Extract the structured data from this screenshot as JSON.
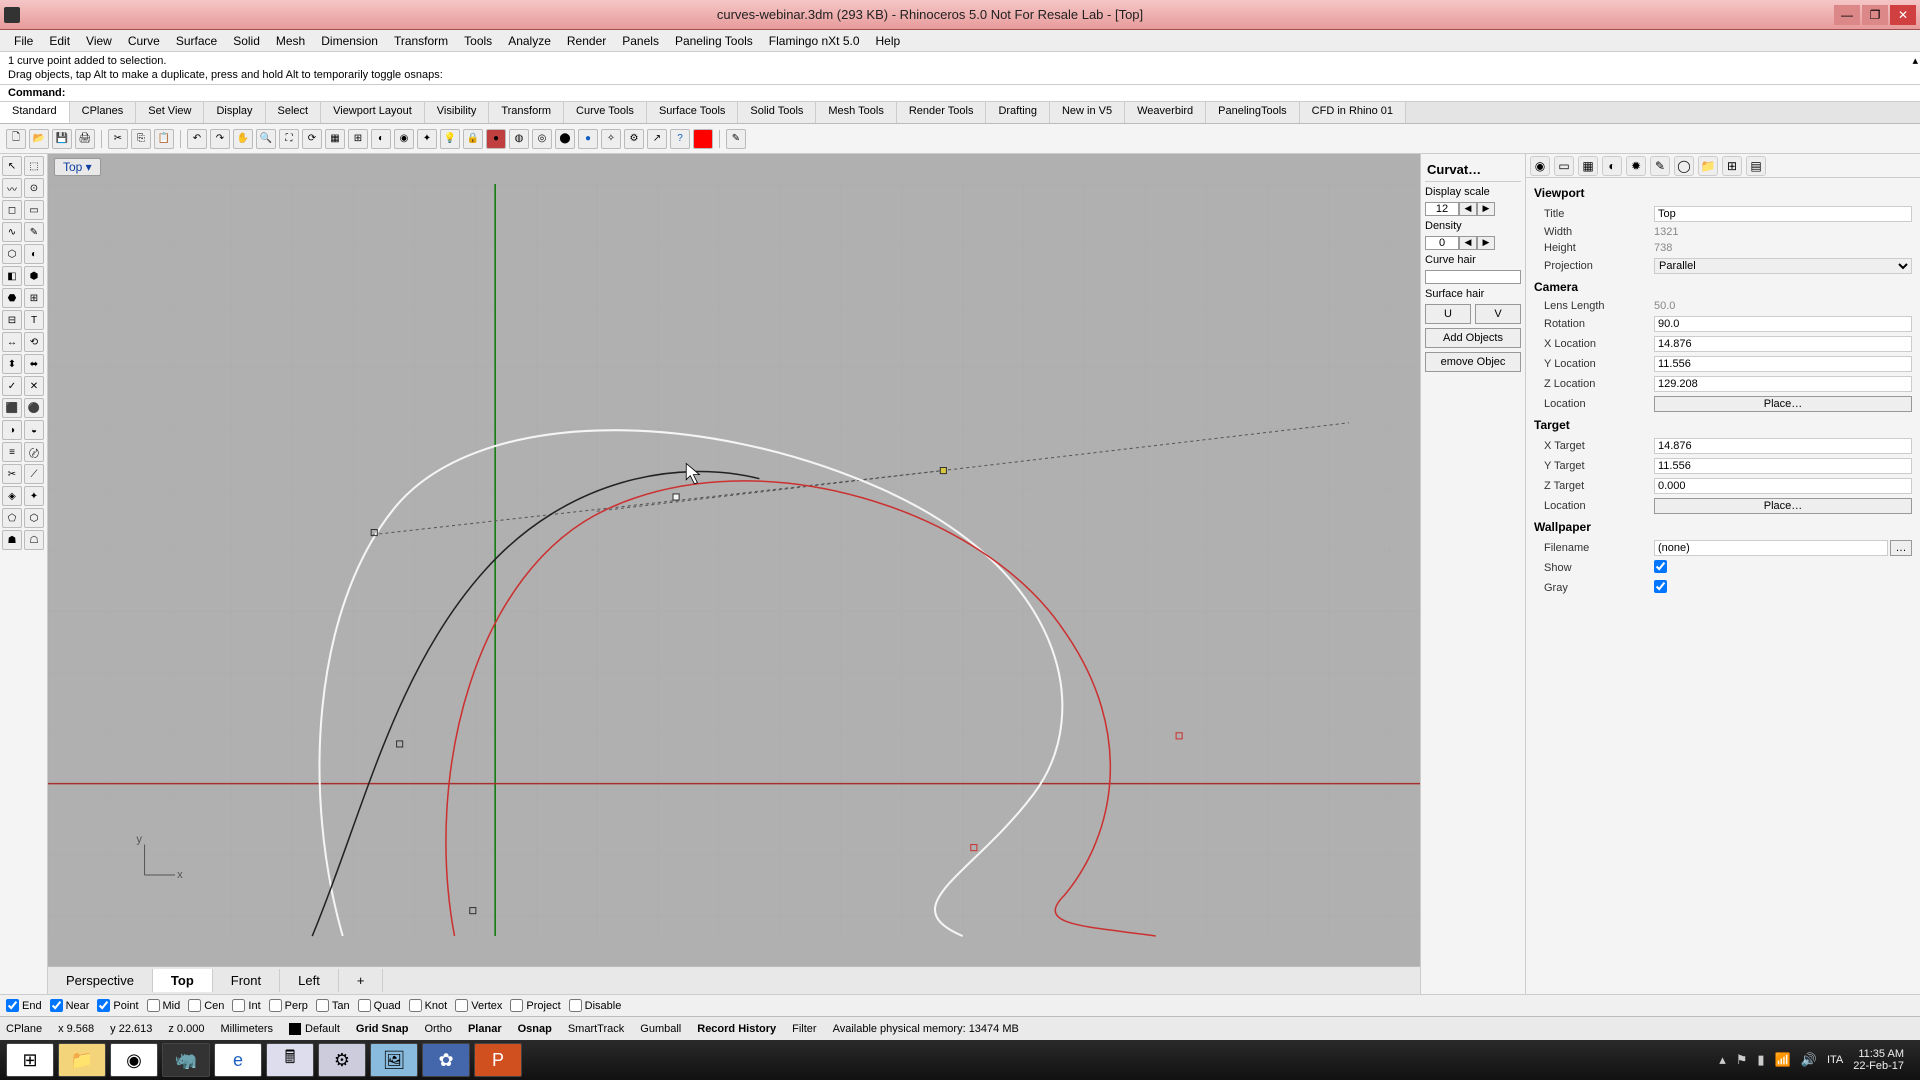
{
  "window": {
    "title": "curves-webinar.3dm (293 KB) - Rhinoceros 5.0 Not For Resale Lab - [Top]"
  },
  "menu": [
    "File",
    "Edit",
    "View",
    "Curve",
    "Surface",
    "Solid",
    "Mesh",
    "Dimension",
    "Transform",
    "Tools",
    "Analyze",
    "Render",
    "Panels",
    "Paneling Tools",
    "Flamingo nXt 5.0",
    "Help"
  ],
  "command_history": {
    "line1": "1 curve point added to selection.",
    "line2": "Drag objects, tap Alt to make a duplicate, press and hold Alt to temporarily toggle osnaps:"
  },
  "command_label": "Command:",
  "command_value": "",
  "tabs": [
    "Standard",
    "CPlanes",
    "Set View",
    "Display",
    "Select",
    "Viewport Layout",
    "Visibility",
    "Transform",
    "Curve Tools",
    "Surface Tools",
    "Solid Tools",
    "Mesh Tools",
    "Render Tools",
    "Drafting",
    "New in V5",
    "Weaverbird",
    "PanelingTools",
    "CFD in Rhino 01"
  ],
  "active_tab": 0,
  "viewport_label": "Top ▾",
  "viewport_tabs": [
    "Perspective",
    "Top",
    "Front",
    "Left",
    "+"
  ],
  "active_viewport_tab": 1,
  "curvat": {
    "title": "Curvat…",
    "display_scale_label": "Display scale",
    "display_scale_value": "12",
    "density_label": "Density",
    "density_value": "0",
    "curve_hair_label": "Curve hair",
    "surface_hair_label": "Surface hair",
    "u_btn": "U",
    "v_btn": "V",
    "add_btn": "Add Objects",
    "remove_btn": "emove Objec"
  },
  "props": {
    "viewport_h": "Viewport",
    "title_l": "Title",
    "title_v": "Top",
    "width_l": "Width",
    "width_v": "1321",
    "height_l": "Height",
    "height_v": "738",
    "projection_l": "Projection",
    "projection_v": "Parallel",
    "camera_h": "Camera",
    "lens_l": "Lens Length",
    "lens_v": "50.0",
    "rot_l": "Rotation",
    "rot_v": "90.0",
    "xloc_l": "X Location",
    "xloc_v": "14.876",
    "yloc_l": "Y Location",
    "yloc_v": "11.556",
    "zloc_l": "Z Location",
    "zloc_v": "129.208",
    "loc_l": "Location",
    "place_btn": "Place…",
    "target_h": "Target",
    "xt_l": "X Target",
    "xt_v": "14.876",
    "yt_l": "Y Target",
    "yt_v": "11.556",
    "zt_l": "Z Target",
    "zt_v": "0.000",
    "wallpaper_h": "Wallpaper",
    "fn_l": "Filename",
    "fn_v": "(none)",
    "show_l": "Show",
    "gray_l": "Gray"
  },
  "osnaps": [
    {
      "label": "End",
      "checked": true
    },
    {
      "label": "Near",
      "checked": true
    },
    {
      "label": "Point",
      "checked": true
    },
    {
      "label": "Mid",
      "checked": false
    },
    {
      "label": "Cen",
      "checked": false
    },
    {
      "label": "Int",
      "checked": false
    },
    {
      "label": "Perp",
      "checked": false
    },
    {
      "label": "Tan",
      "checked": false
    },
    {
      "label": "Quad",
      "checked": false
    },
    {
      "label": "Knot",
      "checked": false
    },
    {
      "label": "Vertex",
      "checked": false
    },
    {
      "label": "Project",
      "checked": false
    },
    {
      "label": "Disable",
      "checked": false
    }
  ],
  "status": {
    "cplane": "CPlane",
    "x": "x 9.568",
    "y": "y 22.613",
    "z": "z 0.000",
    "units": "Millimeters",
    "layer": "Default",
    "toggles": [
      {
        "label": "Grid Snap",
        "bold": true
      },
      {
        "label": "Ortho",
        "bold": false
      },
      {
        "label": "Planar",
        "bold": true
      },
      {
        "label": "Osnap",
        "bold": true
      },
      {
        "label": "SmartTrack",
        "bold": false
      },
      {
        "label": "Gumball",
        "bold": false
      },
      {
        "label": "Record History",
        "bold": true
      },
      {
        "label": "Filter",
        "bold": false
      }
    ],
    "memory": "Available physical memory: 13474 MB"
  },
  "taskbar": {
    "lang": "ITA",
    "time": "11:35 AM",
    "date": "22-Feb-17"
  },
  "icons": {
    "new": "🗋",
    "open": "📂",
    "save": "💾",
    "print": "🖨",
    "cut": "✂",
    "copy": "⎘",
    "paste": "📋",
    "undo": "↶",
    "redo": "↷",
    "pan": "✋",
    "zoom": "🔍",
    "zoomext": "⛶",
    "rotate": "⟳"
  }
}
